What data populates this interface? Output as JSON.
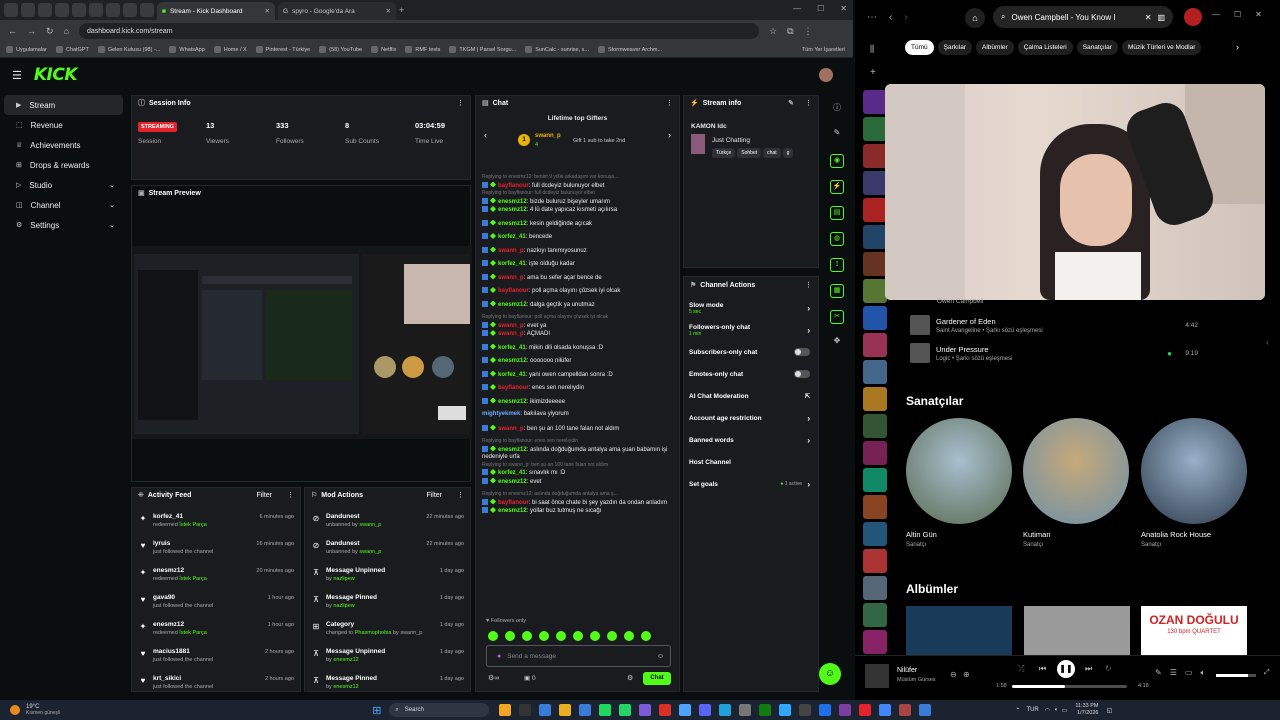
{
  "browser": {
    "tab_title": "Stream - Kick Dashboard",
    "tab2_title": "spyro - Google'da Ara",
    "url": "dashboard.kick.com/stream",
    "bookmarks": [
      "Uygulamalar",
      "ChatGPT",
      "Gelen Kutusu (98) -...",
      "WhatsApp",
      "Home / X",
      "Pinterest - Türkiye",
      "(58) YouTube",
      "Netflix",
      "RMF tests",
      "TKGM | Parsel Sorgu...",
      "SunCalc - sunrise, s...",
      "Stormweaver Archm..."
    ],
    "all_bookmarks": "Tüm Yer İşaretleri"
  },
  "brand": {
    "logo": "KICK",
    "accent": "#53fc18"
  },
  "sidebar": {
    "items": [
      {
        "label": "Stream"
      },
      {
        "label": "Revenue"
      },
      {
        "label": "Achievements"
      },
      {
        "label": "Drops & rewards"
      },
      {
        "label": "Studio"
      },
      {
        "label": "Channel"
      },
      {
        "label": "Settings"
      }
    ]
  },
  "session": {
    "title": "Session Info",
    "status": "STREAMING",
    "status_label": "Session",
    "viewers": "13",
    "viewers_l": "Viewers",
    "followers": "333",
    "followers_l": "Followers",
    "subs": "8",
    "subs_l": "Sub Counts",
    "time": "03:04:59",
    "time_l": "Time Live"
  },
  "preview": {
    "title": "Stream Preview"
  },
  "activity": {
    "title": "Activity Feed",
    "filter": "Filter",
    "rows": [
      {
        "name": "korfez_41",
        "desc_pre": "redeemed ",
        "desc_hl": "İstek Parça",
        "time": "6 minutes ago",
        "icon": "✦"
      },
      {
        "name": "lyruis",
        "desc_pre": "just followed the channel",
        "desc_hl": "",
        "time": "16 minutes ago",
        "icon": "♥"
      },
      {
        "name": "enesmz12",
        "desc_pre": "redeemed ",
        "desc_hl": "İstek Parça",
        "time": "20 minutes ago",
        "icon": "✦"
      },
      {
        "name": "gava90",
        "desc_pre": "just followed the channel",
        "desc_hl": "",
        "time": "1 hour ago",
        "icon": "♥"
      },
      {
        "name": "enesmz12",
        "desc_pre": "redeemed ",
        "desc_hl": "İstek Parça",
        "time": "1 hour ago",
        "icon": "✦"
      },
      {
        "name": "macius1881",
        "desc_pre": "just followed the channel",
        "desc_hl": "",
        "time": "2 hours ago",
        "icon": "♥"
      },
      {
        "name": "krt_sikici",
        "desc_pre": "just followed the channel",
        "desc_hl": "",
        "time": "2 hours ago",
        "icon": "♥"
      }
    ]
  },
  "modactions": {
    "title": "Mod Actions",
    "filter": "Filter",
    "rows": [
      {
        "name": "Dandunest",
        "pre": "unbanned by ",
        "by": "swann_p",
        "time": "22 minutes ago",
        "icon": "⊘"
      },
      {
        "name": "Dandunest",
        "pre": "unbanned by ",
        "by": "swann_p",
        "time": "22 minutes ago",
        "icon": "⊘"
      },
      {
        "name": "Message Unpinned",
        "pre": "by ",
        "by": "nazlipew",
        "time": "1 day ago",
        "icon": "⊼"
      },
      {
        "name": "Message Pinned",
        "pre": "by ",
        "by": "nazlipew",
        "time": "1 day ago",
        "icon": "⊼"
      },
      {
        "name": "Category",
        "pre": "changed to ",
        "by": "Phasmophobia",
        "by2": " by swann_p",
        "time": "1 day ago",
        "icon": "⊞"
      },
      {
        "name": "Message Unpinned",
        "pre": "by ",
        "by": "enesmz12",
        "time": "1 day ago",
        "icon": "⊼"
      },
      {
        "name": "Message Pinned",
        "pre": "by ",
        "by": "enesmz12",
        "time": "1 day ago",
        "icon": "⊼"
      }
    ]
  },
  "chat": {
    "title": "Chat",
    "gifters_title": "Lifetime top Gifters",
    "gifter": "swann_p",
    "gifter_count": "4",
    "gift_msg": "Gift 1 sub to take 2nd",
    "followers_only": "Followers only",
    "placeholder": "Send a message",
    "send": "Chat",
    "counter": "0",
    "messages": [
      {
        "rep": "Replying to enesmz12: benim 9 yıllık arkadaşım var konuşa...",
        "user": "bayflanour",
        "color": "#e4232d",
        "text": ": full dcdeyiz bulunuyor elbet"
      },
      {
        "rep": "Replying to bayflanour: full dcdeyiz bulunuyor elbet",
        "user": "enesmz12",
        "color": "#53fc18",
        "text": ": bizde buluruz bişeyler umarım"
      },
      {
        "rep": "",
        "user": "enesmz12",
        "color": "#53fc18",
        "text": ": 4 lü date yapıcaz kısmeti açılırsa"
      },
      {
        "rep": "",
        "user": "enesmz12",
        "color": "#53fc18",
        "text": ": kesin geldiğinde açıcak"
      },
      {
        "rep": "",
        "user": "korfez_41",
        "color": "#53fc18",
        "text": ": bencede"
      },
      {
        "rep": "",
        "user": "swann_p",
        "color": "#e4232d",
        "text": ": nazkıyı tanımıyosunuz"
      },
      {
        "rep": "",
        "user": "korfez_41",
        "color": "#53fc18",
        "text": ": işte olduğu kadar"
      },
      {
        "rep": "",
        "user": "swann_p",
        "color": "#e4232d",
        "text": ": ama bu sefer açar bence de"
      },
      {
        "rep": "",
        "user": "bayflanour",
        "color": "#e4232d",
        "text": ": poll açma olayını çözsek iyi olcak"
      },
      {
        "rep": "",
        "user": "enesmz12",
        "color": "#53fc18",
        "text": ": dalga geçtik ya unutmaz"
      },
      {
        "rep": "Replying to bayflanour: poll açma olayını çözsek iyi olcak",
        "user": "swann_p",
        "color": "#e4232d",
        "text": ": evet ya"
      },
      {
        "rep": "",
        "user": "swann_p",
        "color": "#e4232d",
        "text": ": AÇMADI"
      },
      {
        "rep": "",
        "user": "korfez_41",
        "color": "#53fc18",
        "text": ": mikin dili olsada konuşsa :D"
      },
      {
        "rep": "",
        "user": "enesmz12",
        "color": "#53fc18",
        "text": ": ooooooo nilüfer"
      },
      {
        "rep": "",
        "user": "korfez_41",
        "color": "#53fc18",
        "text": ": yani owen campelldan sonra :D"
      },
      {
        "rep": "",
        "user": "bayflanour",
        "color": "#e4232d",
        "text": ": enes sen nerelıydin"
      },
      {
        "rep": "",
        "user": "enesmz12",
        "color": "#53fc18",
        "text": ": ikimizdeeeee"
      },
      {
        "rep": "",
        "user": "mightyekmek",
        "color": "#6ba9ff",
        "text": ": bakılava yiyorum"
      },
      {
        "rep": "",
        "user": "swann_p",
        "color": "#e4232d",
        "text": ": ben şu an 100 tane falan not aldım"
      },
      {
        "rep": "Replying to bayflanour: enes sen nerelıydin",
        "user": "enesmz12",
        "color": "#53fc18",
        "text": ": aslında doğduğumda antalya ama şuan babamın işi nedeniyle urfa"
      },
      {
        "rep": "Replying to swann_p: ben şu an 100 tane falan not aldım",
        "user": "korfez_41",
        "color": "#53fc18",
        "text": ": sınavlık mı :D"
      },
      {
        "rep": "",
        "user": "enesmz12",
        "color": "#53fc18",
        "text": ": evet"
      },
      {
        "rep": "Replying to enesmz12: aslında doğduğumda antalya ama ş...",
        "user": "bayflanour",
        "color": "#e4232d",
        "text": ": bi saat önce chate bi şey yazdın da ondan anladım"
      },
      {
        "rep": "",
        "user": "enesmz12",
        "color": "#53fc18",
        "text": ": yollar buz tutmuş ne sıcağı"
      }
    ]
  },
  "streaminfo": {
    "title": "Stream info",
    "streamer": "KAMON Idc",
    "category": "Just Chatting",
    "tags": [
      "Türkçe",
      "Sohbet",
      "chat",
      "g"
    ]
  },
  "channel_actions": {
    "title": "Channel Actions",
    "rows": [
      {
        "label": "Slow mode",
        "sub": "5 sec",
        "kind": "arrow"
      },
      {
        "label": "Followers-only chat",
        "sub": "1 min",
        "kind": "arrow"
      },
      {
        "label": "Subscribers-only chat",
        "sub": "",
        "kind": "toggle"
      },
      {
        "label": "Emotes-only chat",
        "sub": "",
        "kind": "toggle"
      },
      {
        "label": "AI Chat Moderation",
        "sub": "",
        "kind": "ext"
      },
      {
        "label": "Account age restriction",
        "sub": "",
        "kind": "arrow"
      },
      {
        "label": "Banned words",
        "sub": "",
        "kind": "arrow"
      },
      {
        "label": "Host Channel",
        "sub": "",
        "kind": "none"
      },
      {
        "label": "Set goals",
        "sub": "",
        "kind": "active",
        "extra": "1 active"
      }
    ]
  },
  "spotify": {
    "search": "Owen Campbell - You Know I",
    "chips": [
      "Tümü",
      "Şarkılar",
      "Albümler",
      "Çalma Listeleri",
      "Sanatçılar",
      "Müzik Türleri ve Modlar"
    ],
    "prev_track_artist": "Owen Campbell",
    "tracks": [
      {
        "title": "Gardener of Eden",
        "sub": "Saint Avangeline • Şarkı sözü eşleşmesi",
        "dur": "4:42"
      },
      {
        "title": "Under Pressure",
        "sub": "Logic • Şarkı sözü eşleşmesi",
        "dur": "9:19"
      }
    ],
    "artists_title": "Sanatçılar",
    "artists": [
      {
        "name": "Altin Gün",
        "role": "Sanatçı"
      },
      {
        "name": "Kutiman",
        "role": "Sanatçı"
      },
      {
        "name": "Anatolia Rock House",
        "role": "Sanatçı"
      }
    ],
    "albums_title": "Albümler",
    "album3_text": "OZAN DOĞULU",
    "album3_sub": "130 bpm QUARTET",
    "now_title": "Nilüfer",
    "now_artist": "Müslüm Gürses",
    "elapsed": "1:58",
    "total": "4:18",
    "progress": 0.46
  },
  "taskbar": {
    "weather": "19°C",
    "weather_desc": "Kısmen güneşli",
    "search": "Search",
    "lang": "TUR",
    "time": "11:33 PM",
    "date": "1/7/2026"
  }
}
